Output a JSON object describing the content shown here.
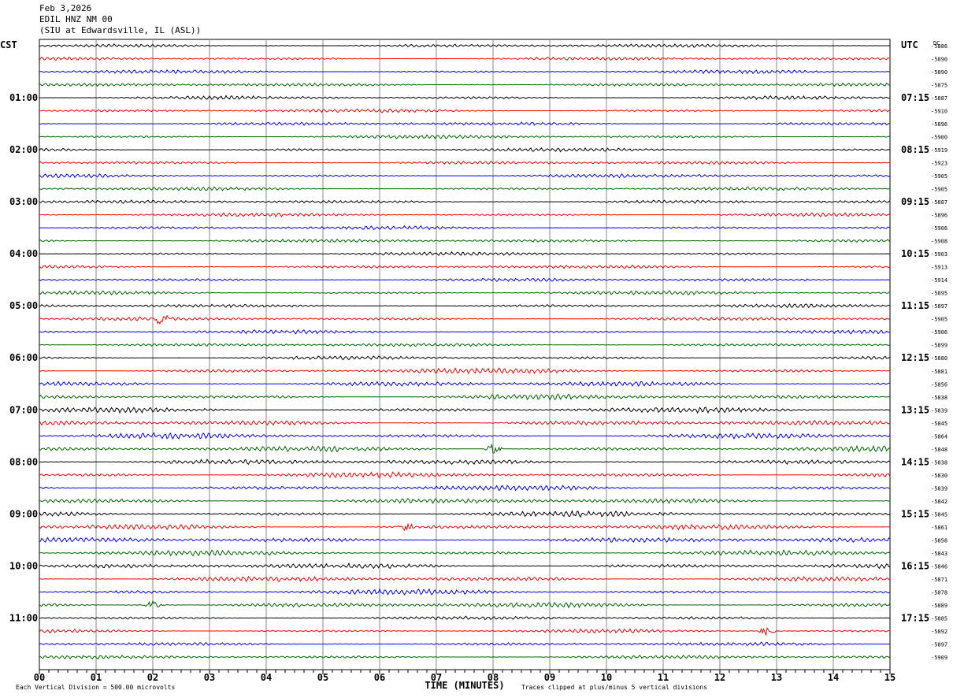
{
  "header": {
    "date": "Feb 3,2026",
    "station": "EDIL HNZ NM 00",
    "location": "(SIU at Edwardsville, IL  (ASL))"
  },
  "chart_data": {
    "type": "line",
    "title": "Feb 3,2026 EDIL HNZ NM 00 (SIU at Edwardsville, IL (ASL))",
    "xlabel": "TIME (MINUTES)",
    "xlim": [
      0,
      15
    ],
    "x_ticks": [
      "00",
      "01",
      "02",
      "03",
      "04",
      "05",
      "06",
      "07",
      "08",
      "09",
      "10",
      "11",
      "12",
      "13",
      "14",
      "15"
    ],
    "left_axis_label": "CST",
    "right_axis_label": "UTC",
    "dc_label": "DC",
    "left_hour_labels": [
      "01:00",
      "02:00",
      "03:00",
      "04:00",
      "05:00",
      "06:00",
      "07:00",
      "08:00",
      "09:00",
      "10:00",
      "11:00"
    ],
    "right_hour_labels": [
      "07:15",
      "08:15",
      "09:15",
      "10:15",
      "11:15",
      "12:15",
      "13:15",
      "14:15",
      "15:15",
      "16:15",
      "17:15"
    ],
    "trace_colors": [
      "#000000",
      "#ff0000",
      "#0000ff",
      "#006400"
    ],
    "dc_offsets": [
      -5886,
      -5890,
      -5890,
      -5875,
      -5887,
      -5910,
      -5896,
      -5900,
      -5919,
      -5923,
      -5905,
      -5905,
      -5887,
      -5896,
      -5906,
      -5908,
      -5903,
      -5913,
      -5914,
      -5895,
      -5897,
      -5905,
      -5906,
      -5899,
      -5880,
      -5881,
      -5856,
      -5838,
      -5839,
      -5845,
      -5864,
      -5848,
      -5838,
      -5830,
      -5839,
      -5842,
      -5845,
      -5861,
      -5858,
      -5843,
      -5846,
      -5871,
      -5878,
      -5889,
      -5885,
      -5892,
      -5897,
      -5909
    ],
    "events": [
      {
        "trace": 21,
        "minute": 2.15,
        "amplitude": 5
      },
      {
        "trace": 37,
        "minute": 6.45,
        "amplitude": 3
      },
      {
        "trace": 45,
        "minute": 12.85,
        "amplitude": 3
      },
      {
        "trace": 31,
        "minute": 8.0,
        "amplitude": 3
      },
      {
        "trace": 43,
        "minute": 2.0,
        "amplitude": 3
      }
    ],
    "footer_left": "Each Vertical Division =  500.00 microvolts",
    "footer_right": "Traces clipped at plus/minus 5 vertical divisions"
  }
}
